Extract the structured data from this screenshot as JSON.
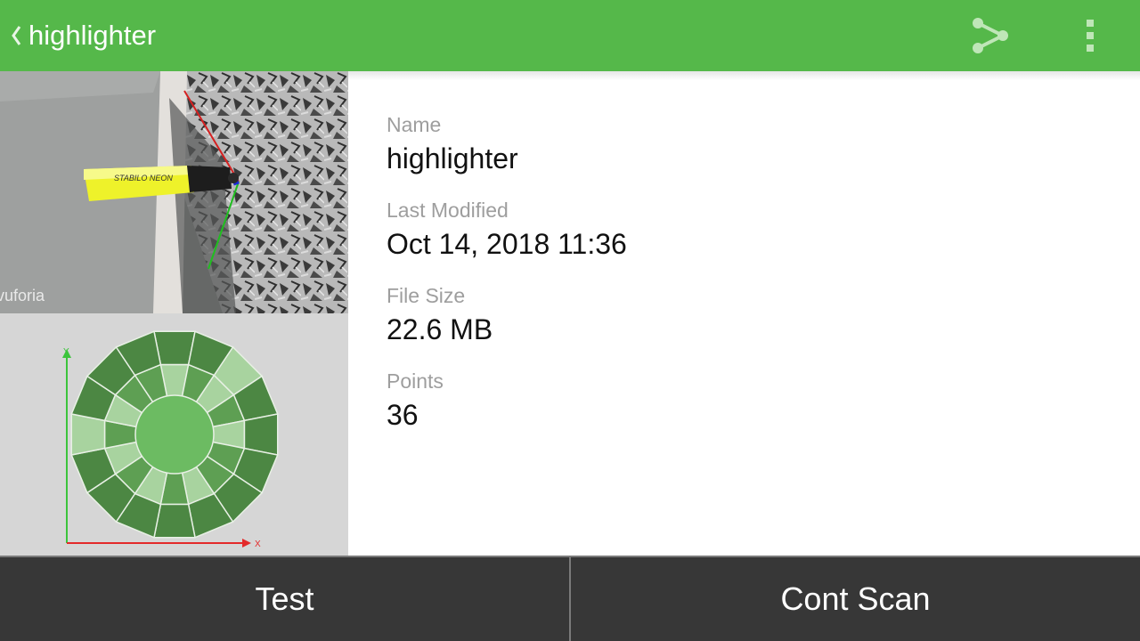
{
  "app_bar": {
    "title": "highlighter",
    "back_icon": "chevron-left-icon",
    "share_icon": "share-icon",
    "more_icon": "more-vert-icon",
    "color": "#55b84a"
  },
  "preview": {
    "watermark": "vuforia",
    "object_label": "STABILO NEON"
  },
  "coverage_map": {
    "y_axis_label": "Y",
    "x_axis_label": "X"
  },
  "details": {
    "name_label": "Name",
    "name_value": "highlighter",
    "modified_label": "Last Modified",
    "modified_value": "Oct 14, 2018 11:36",
    "size_label": "File Size",
    "size_value": "22.6 MB",
    "points_label": "Points",
    "points_value": "36"
  },
  "actions": {
    "test_label": "Test",
    "cont_scan_label": "Cont Scan"
  }
}
